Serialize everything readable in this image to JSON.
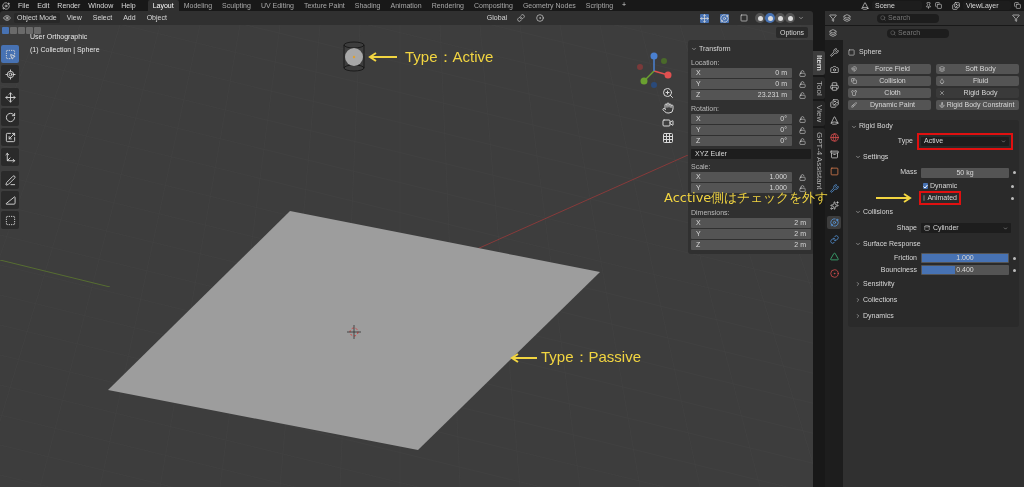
{
  "menu": [
    "File",
    "Edit",
    "Render",
    "Window",
    "Help"
  ],
  "workspaces": [
    {
      "label": "Layout",
      "selected": true
    },
    {
      "label": "Modeling",
      "selected": false
    },
    {
      "label": "Sculpting",
      "selected": false
    },
    {
      "label": "UV Editing",
      "selected": false
    },
    {
      "label": "Texture Paint",
      "selected": false
    },
    {
      "label": "Shading",
      "selected": false
    },
    {
      "label": "Animation",
      "selected": false
    },
    {
      "label": "Rendering",
      "selected": false
    },
    {
      "label": "Compositing",
      "selected": false
    },
    {
      "label": "Geometry Nodes",
      "selected": false
    },
    {
      "label": "Scripting",
      "selected": false
    }
  ],
  "add_workspace": "+",
  "scene": "Scene",
  "view_layer": "ViewLayer",
  "outliner": {
    "search_placeholder": "Search"
  },
  "viewport": {
    "mode": "Object Mode",
    "menus": [
      "View",
      "Select",
      "Add",
      "Object"
    ],
    "orientation": "Global",
    "options": "Options",
    "info": [
      "User Orthographic",
      "(1) Collection | Sphere"
    ],
    "select_modes": [
      {
        "selected": true
      },
      {
        "selected": false
      },
      {
        "selected": false
      },
      {
        "selected": false
      },
      {
        "selected": false
      }
    ],
    "shading": [
      {
        "selected": false
      },
      {
        "selected": true
      },
      {
        "selected": false
      },
      {
        "selected": false
      }
    ],
    "tools": [
      {
        "selected": true
      },
      {
        "selected": false
      },
      {
        "selected": false
      },
      {
        "selected": false
      },
      {
        "selected": false
      },
      {
        "selected": false
      },
      {
        "selected": false
      },
      {
        "selected": false
      },
      {
        "selected": false
      }
    ]
  },
  "annotations": [
    {
      "text": "Type：Active"
    },
    {
      "text": "Type：Passive"
    },
    {
      "text": "Acctive側はチェックを外す"
    }
  ],
  "transform": {
    "title": "Transform",
    "groups": [
      {
        "label": "Location:",
        "locks": true,
        "fields": [
          {
            "axis": "X",
            "value": "0 m"
          },
          {
            "axis": "Y",
            "value": "0 m"
          },
          {
            "axis": "Z",
            "value": "23.231 m"
          }
        ]
      },
      {
        "label": "Rotation:",
        "locks": true,
        "fields": [
          {
            "axis": "X",
            "value": "0°"
          },
          {
            "axis": "Y",
            "value": "0°"
          },
          {
            "axis": "Z",
            "value": "0°"
          }
        ],
        "mode": "XYZ Euler"
      },
      {
        "label": "Scale:",
        "locks": true,
        "fields": [
          {
            "axis": "X",
            "value": "1.000"
          },
          {
            "axis": "Y",
            "value": "1.000"
          }
        ]
      },
      {
        "label": "Dimensions:",
        "locks": false,
        "fields": [
          {
            "axis": "X",
            "value": "2 m"
          },
          {
            "axis": "Y",
            "value": "2 m"
          },
          {
            "axis": "Z",
            "value": "2 m"
          }
        ]
      }
    ]
  },
  "side_tabs": [
    {
      "label": "Item",
      "selected": true
    },
    {
      "label": "Tool",
      "selected": false
    },
    {
      "label": "View",
      "selected": false
    },
    {
      "label": "GPT-4 Assistant",
      "selected": false
    }
  ],
  "properties": {
    "search_placeholder": "Search",
    "object": "Sphere",
    "tabs": [
      {
        "selected": false
      },
      {
        "selected": false
      },
      {
        "selected": false
      },
      {
        "selected": false
      },
      {
        "selected": false
      },
      {
        "selected": false
      },
      {
        "selected": false
      },
      {
        "selected": false
      },
      {
        "selected": false
      },
      {
        "selected": false
      },
      {
        "selected": true
      },
      {
        "selected": false
      },
      {
        "selected": false
      },
      {
        "selected": false
      }
    ],
    "physics": [
      {
        "label": "Force Field",
        "enabled": false
      },
      {
        "label": "Soft Body",
        "enabled": false
      },
      {
        "label": "Collision",
        "enabled": false
      },
      {
        "label": "Fluid",
        "enabled": false
      },
      {
        "label": "Cloth",
        "enabled": false
      },
      {
        "label": "Rigid Body",
        "enabled": true
      },
      {
        "label": "Dynamic Paint",
        "enabled": false
      },
      {
        "label": "Rigid Body Constraint",
        "enabled": false
      }
    ],
    "rigid_body": {
      "title": "Rigid Body",
      "expanded": true,
      "type_label": "Type",
      "type_value": "Active",
      "type_highlighted": true,
      "sections": [
        {
          "title": "Settings",
          "expanded": true,
          "rows": [
            {
              "kind": "field",
              "label": "Mass",
              "value": "50 kg"
            },
            {
              "kind": "checkbox",
              "label": "Dynamic",
              "checked": true,
              "highlighted": false
            },
            {
              "kind": "checkbox",
              "label": "Animated",
              "checked": false,
              "highlighted": true
            }
          ]
        },
        {
          "title": "Collisions",
          "expanded": true,
          "rows": [
            {
              "kind": "dropdown",
              "label": "Shape",
              "value": "Cylinder"
            }
          ]
        },
        {
          "title": "Surface Response",
          "expanded": true,
          "rows": [
            {
              "kind": "slider",
              "label": "Friction",
              "value": "1.000",
              "level": 1
            },
            {
              "kind": "slider",
              "label": "Bounciness",
              "value": "0.400",
              "level": 0.4
            }
          ]
        },
        {
          "title": "Sensitivity",
          "expanded": false
        },
        {
          "title": "Collections",
          "expanded": false
        },
        {
          "title": "Dynamics",
          "expanded": false
        }
      ]
    }
  }
}
